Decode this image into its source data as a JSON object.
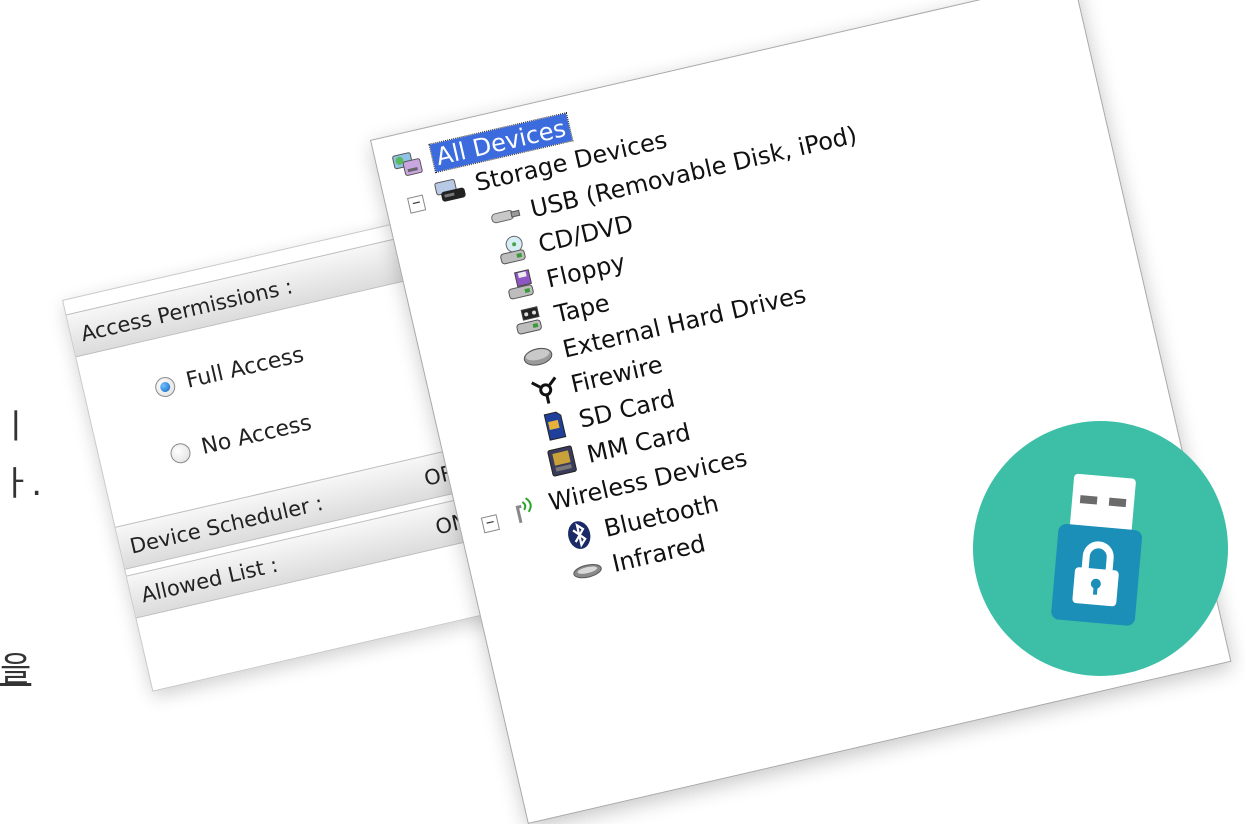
{
  "background_text": {
    "line1": "ㅣ",
    "line2": "ㅏ.",
    "line3": "을"
  },
  "permissions": {
    "header": "Access Permissions :",
    "options": [
      {
        "label": "Full Access",
        "selected": true
      },
      {
        "label": "No Access",
        "selected": false
      }
    ],
    "scheduler": {
      "label": "Device Scheduler :",
      "value": "OF"
    },
    "allowed": {
      "label": "Allowed List :",
      "value": "ON"
    }
  },
  "tree": {
    "root": {
      "label": "All Devices",
      "icon": "all-devices-icon",
      "selected": true
    },
    "storage": {
      "label": "Storage Devices",
      "icon": "storage-devices-icon",
      "expander": "−",
      "items": [
        {
          "label": "USB (Removable Disk, iPod)",
          "icon": "usb-drive-icon"
        },
        {
          "label": "CD/DVD",
          "icon": "cd-dvd-drive-icon"
        },
        {
          "label": "Floppy",
          "icon": "floppy-drive-icon"
        },
        {
          "label": "Tape",
          "icon": "tape-drive-icon"
        },
        {
          "label": "External Hard Drives",
          "icon": "external-hard-drive-icon"
        },
        {
          "label": "Firewire",
          "icon": "firewire-icon"
        },
        {
          "label": "SD Card",
          "icon": "sd-card-icon"
        },
        {
          "label": "MM Card",
          "icon": "mm-card-icon"
        }
      ]
    },
    "wireless": {
      "label": "Wireless Devices",
      "icon": "wireless-devices-icon",
      "expander": "−",
      "items": [
        {
          "label": "Bluetooth",
          "icon": "bluetooth-icon"
        },
        {
          "label": "Infrared",
          "icon": "infrared-icon"
        }
      ]
    }
  },
  "badge": {
    "icon": "usb-lock-icon",
    "color": "#3cbfa6",
    "accent": "#1b8fb8"
  },
  "colors": {
    "selection": "#3b6bdc",
    "header_bg": "#dcdcdc"
  }
}
